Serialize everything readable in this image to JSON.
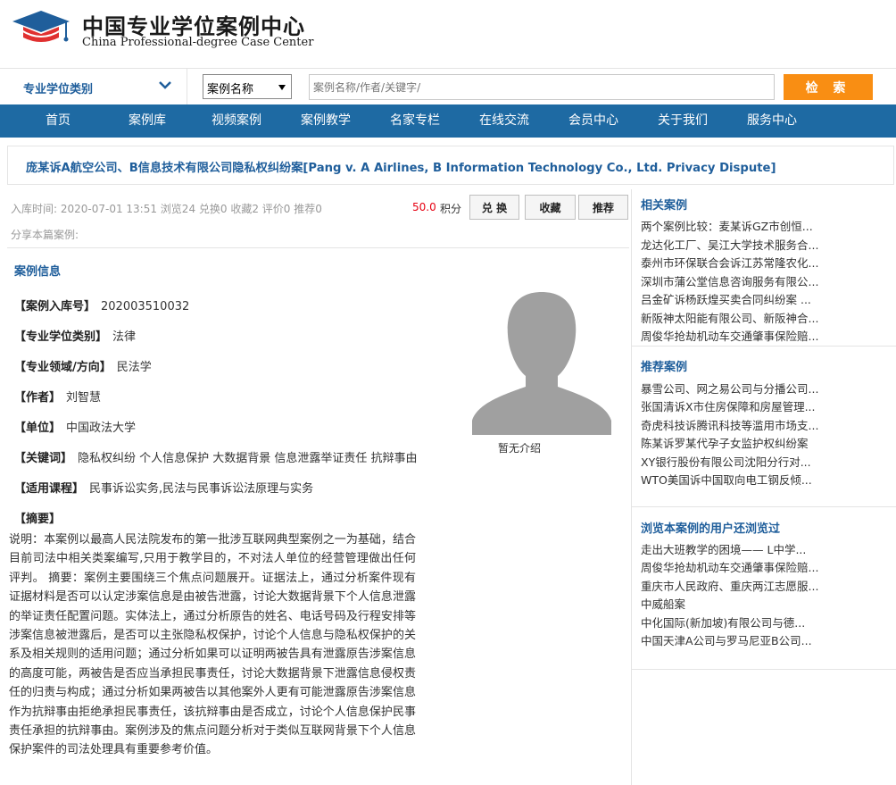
{
  "header": {
    "logo_cn": "中国专业学位案例中心",
    "logo_en": "China Professional-degree Case Center"
  },
  "search": {
    "category_label": "专业学位类别",
    "type_label": "案例名称",
    "placeholder": "案例名称/作者/关键字/",
    "button_label": "检 索"
  },
  "nav": [
    "首页",
    "案例库",
    "视频案例",
    "案例教学",
    "名家专栏",
    "在线交流",
    "会员中心",
    "关于我们",
    "服务中心"
  ],
  "case": {
    "title": "庞某诉A航空公司、B信息技术有限公司隐私权纠纷案[Pang v. A Airlines, B Information Technology Co., Ltd. Privacy Dispute]",
    "meta": "入库时间: 2020-07-01 13:51   浏览24  兑换0 收藏2 评价0 推荐0",
    "share": "分享本篇案例:",
    "points": "50.0",
    "points_unit": "积分",
    "btn_exchange": "兑 换",
    "btn_favorite": "收藏",
    "btn_recommend": "推荐"
  },
  "info": {
    "heading": "案例信息",
    "fields": [
      {
        "label": "【案例入库号】",
        "value": "202003510032"
      },
      {
        "label": "【专业学位类别】",
        "value": "法律"
      },
      {
        "label": "【专业领域/方向】",
        "value": "民法学"
      },
      {
        "label": "【作者】",
        "value": "刘智慧"
      },
      {
        "label": "【单位】",
        "value": "中国政法大学"
      },
      {
        "label": "【关键词】",
        "value": "隐私权纠纷 个人信息保护 大数据背景 信息泄露举证责任 抗辩事由"
      },
      {
        "label": "【适用课程】",
        "value": "民事诉讼实务,民法与民事诉讼法原理与实务"
      },
      {
        "label": "【摘要】",
        "value": ""
      }
    ],
    "abstract": "说明：本案例以最高人民法院发布的第一批涉互联网典型案例之一为基础，结合目前司法中相关类案编写,只用于教学目的，不对法人单位的经营管理做出任何评判。 摘要：案例主要围绕三个焦点问题展开。证据法上，通过分析案件现有证据材料是否可以认定涉案信息是由被告泄露，讨论大数据背景下个人信息泄露的举证责任配置问题。实体法上，通过分析原告的姓名、电话号码及行程安排等涉案信息被泄露后，是否可以主张隐私权保护，讨论个人信息与隐私权保护的关系及相关规则的适用问题；通过分析如果可以证明两被告具有泄露原告涉案信息的高度可能，两被告是否应当承担民事责任，讨论大数据背景下泄露信息侵权责任的归责与构成；通过分析如果两被告以其他案外人更有可能泄露原告涉案信息作为抗辩事由拒绝承担民事责任，该抗辩事由是否成立，讨论个人信息保护民事责任承担的抗辩事由。案例涉及的焦点问题分析对于类似互联网背景下个人信息保护案件的司法处理具有重要参考价值。",
    "avatar_caption": "暂无介绍"
  },
  "sidebar": {
    "related_title": "相关案例",
    "related": [
      "两个案例比较：麦某诉GZ市创恒...",
      "龙达化工厂、吴江大学技术服务合...",
      "泰州市环保联合会诉江苏常隆农化...",
      "深圳市蒲公堂信息咨询服务有限公...",
      "吕金矿诉杨跃煌买卖合同纠纷案 ...",
      "新阪神太阳能有限公司、新阪神合...",
      "周俊华抢劫机动车交通肇事保险赔..."
    ],
    "recommend_title": "推荐案例",
    "recommend": [
      "暴雪公司、网之易公司与分播公司...",
      "张国清诉X市住房保障和房屋管理...",
      "奇虎科技诉腾讯科技等滥用市场支...",
      "陈某诉罗某代孕子女监护权纠纷案",
      "XY银行股份有限公司沈阳分行对...",
      "WTO美国诉中国取向电工钢反倾..."
    ],
    "viewed_title": "浏览本案例的用户还浏览过",
    "viewed": [
      "走出大班教学的困境—— L中学...",
      "周俊华抢劫机动车交通肇事保险赔...",
      "重庆市人民政府、重庆两江志愿服...",
      "中威船案",
      "中化国际(新加坡)有限公司与德...",
      "中国天津A公司与罗马尼亚B公司..."
    ]
  },
  "colors": {
    "brand_blue": "#1e6aa3",
    "link_blue": "#1f5e9b",
    "search_orange": "#f98e13",
    "points_red": "#e60012"
  }
}
